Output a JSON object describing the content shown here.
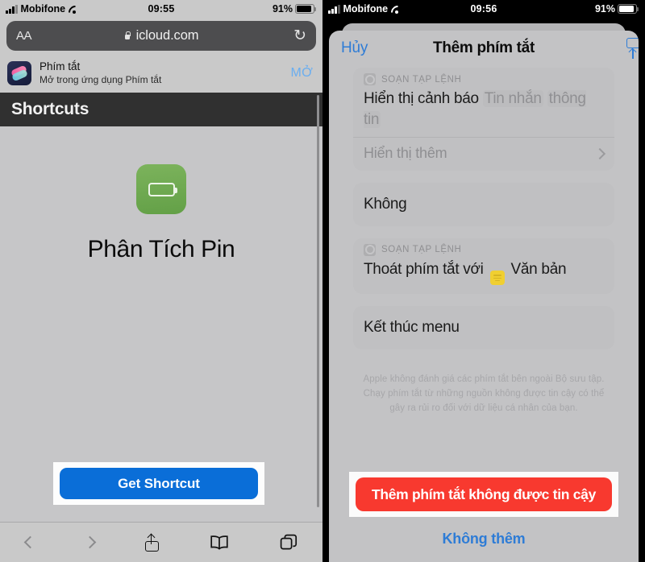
{
  "left": {
    "status": {
      "carrier": "Mobifone",
      "wifi_icon": "wifi-icon",
      "time": "09:55",
      "battery_pct": "91%"
    },
    "browser": {
      "text_size_label": "AA",
      "lock_icon": "lock-icon",
      "url": "icloud.com",
      "reload_icon": "reload-icon"
    },
    "banner": {
      "app_icon": "shortcuts-app-icon",
      "title": "Phím tắt",
      "subtitle": "Mở trong ứng dụng Phím tắt",
      "open_label": "MỞ"
    },
    "page": {
      "header_title": "Shortcuts",
      "shortcut_icon": "battery-icon",
      "shortcut_name": "Phân Tích Pin",
      "cta_label": "Get Shortcut"
    },
    "toolbar": {
      "back_icon": "chevron-left-icon",
      "forward_icon": "chevron-right-icon",
      "share_icon": "share-icon",
      "bookmarks_icon": "book-icon",
      "tabs_icon": "tabs-icon"
    }
  },
  "right": {
    "status": {
      "carrier": "Mobifone",
      "wifi_icon": "wifi-icon",
      "time": "09:56",
      "battery_pct": "91%"
    },
    "nav": {
      "cancel": "Hủy",
      "title": "Thêm phím tắt",
      "share_icon": "share-icon"
    },
    "actions": [
      {
        "app_icon": "scripting-icon",
        "app_label": "SOẠN TẠP LỆNH",
        "line_prefix": "Hiển thị cảnh báo",
        "token_1": "Tin nhắn",
        "token_2": "thông tin",
        "more_label": "Hiển thị thêm",
        "more_icon": "chevron-right-icon"
      },
      {
        "label": "Không"
      },
      {
        "app_icon": "scripting-icon",
        "app_label": "SOẠN TẠP LỆNH",
        "line_prefix": "Thoát phím tắt với",
        "inline_icon": "text-icon",
        "line_suffix": "Văn bản"
      },
      {
        "label": "Kết thúc menu"
      }
    ],
    "warning": "Apple không đánh giá các phím tắt bên ngoài Bộ sưu tập. Chạy phím tắt từ những nguồn không được tin cậy có thể gây ra rủi ro đối với dữ liệu cá nhân của bạn.",
    "confirm_label": "Thêm phím tắt không được tin cậy",
    "decline_label": "Không thêm"
  },
  "colors": {
    "accent_blue": "#0a6ed8",
    "link_blue": "#2e7cd6",
    "danger_red": "#f8392f",
    "shortcut_green": "#63a047",
    "text_token_yellow": "#f2d02c"
  }
}
